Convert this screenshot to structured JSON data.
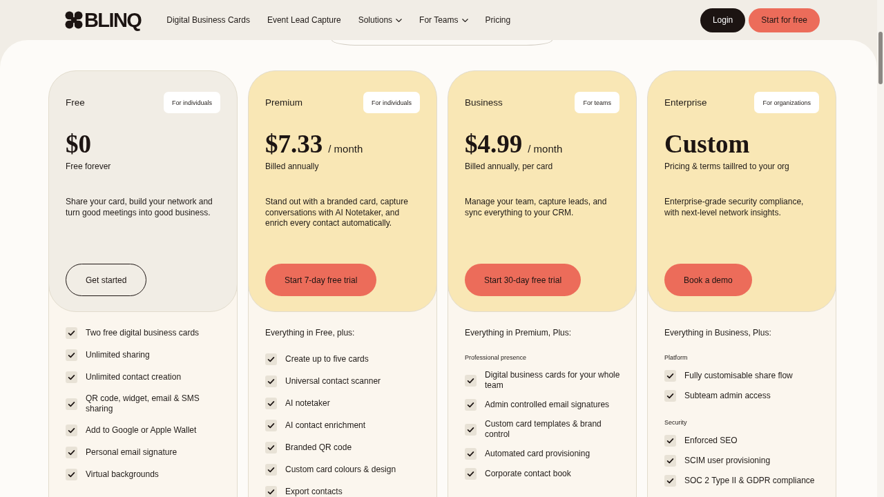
{
  "header": {
    "logo": {
      "text": "BLINQ"
    },
    "nav": [
      {
        "label": "Digital Business Cards",
        "dropdown": false
      },
      {
        "label": "Event Lead Capture",
        "dropdown": false
      },
      {
        "label": "Solutions",
        "dropdown": true
      },
      {
        "label": "For Teams",
        "dropdown": true
      },
      {
        "label": "Pricing",
        "dropdown": false
      }
    ],
    "actions": [
      {
        "label": "Login",
        "kind": "dark"
      },
      {
        "label": "Start for free",
        "kind": "accent"
      }
    ]
  },
  "plans": [
    {
      "name": "Free",
      "audience": "For individuals",
      "color": "#f1ede5",
      "price": "$0",
      "billing": "Free forever",
      "description": "Share your card, build your network and turn good meetings into good business.",
      "button": {
        "label": "Get started",
        "kind": "outline"
      },
      "features": {
        "groups": [
          {
            "items": [
              "Two free digital business cards",
              "Unlimited sharing",
              "Unlimited contact creation",
              "QR code, widget, email & SMS sharing",
              "Add to Google or Apple Wallet",
              "Personal email signature",
              "Virtual backgrounds"
            ]
          }
        ]
      }
    },
    {
      "name": "Premium",
      "audience": "For individuals",
      "color": "#f9e7b5",
      "price": "$7.33",
      "period": "/ month",
      "billing": "Billed annually",
      "description": "Stand out with a branded card, capture conversations with AI Notetaker, and enrich every contact automatically.",
      "button": {
        "label": "Start 7-day free trial",
        "kind": "filled"
      },
      "features": {
        "intro": "Everything in Free, plus:",
        "groups": [
          {
            "items": [
              "Create up to five cards",
              "Universal contact scanner",
              "AI notetaker",
              "AI contact enrichment",
              "Branded QR code",
              "Custom card colours & design",
              "Export contacts"
            ]
          }
        ]
      }
    },
    {
      "name": "Business",
      "audience": "For teams",
      "color": "#f9e7b5",
      "price": "$4.99",
      "period": "/ month",
      "billing": "Billed annually, per card",
      "description": "Manage your team, capture leads, and sync everything to your CRM.",
      "button": {
        "label": "Start 30-day free trial",
        "kind": "filled"
      },
      "features": {
        "intro": "Everything in Premium, Plus:",
        "groups": [
          {
            "heading": "Professional presence",
            "items": [
              "Digital business cards for your whole team",
              "Admin controlled email signatures",
              "Custom card templates & brand control",
              "Automated card provisioning",
              "Corporate contact book"
            ]
          }
        ]
      }
    },
    {
      "name": "Enterprise",
      "audience": "For organizations",
      "color": "#f9e7b5",
      "price": "Custom",
      "billing": "Pricing & terms taillred to your org",
      "description": "Enterprise-grade security compliance, with next-level network insights.",
      "button": {
        "label": "Book a demo",
        "kind": "filled"
      },
      "features": {
        "intro": "Everything in Business, Plus:",
        "groups": [
          {
            "heading": "Platform",
            "items": [
              "Fully customisable share flow",
              "Subteam admin access"
            ]
          },
          {
            "heading": "Security",
            "items": [
              "Enforced SEO",
              "SCIM user provisioning",
              "SOC 2 Type II & GDPR compliance"
            ]
          }
        ]
      }
    }
  ]
}
